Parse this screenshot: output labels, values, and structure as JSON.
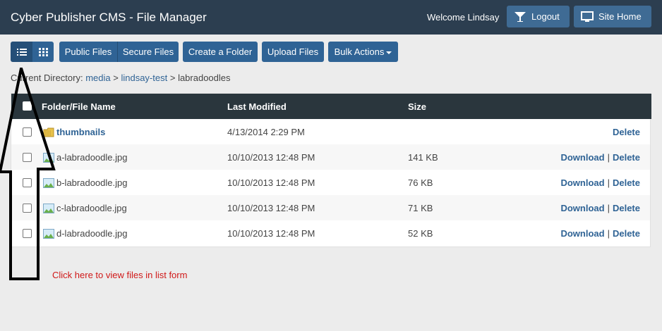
{
  "header": {
    "title": "Cyber Publisher CMS - File Manager",
    "welcome": "Welcome Lindsay",
    "logout_label": "Logout",
    "site_home_label": "Site Home"
  },
  "toolbar": {
    "public_files": "Public Files",
    "secure_files": "Secure Files",
    "create_folder": "Create a Folder",
    "upload_files": "Upload Files",
    "bulk_actions": "Bulk Actions"
  },
  "breadcrumb": {
    "prefix": "Current Directory:",
    "parts": [
      "media",
      "lindsay-test",
      "labradoodles"
    ],
    "sep": ">"
  },
  "table": {
    "headers": [
      "Folder/File Name",
      "Last Modified",
      "Size"
    ],
    "rows": [
      {
        "type": "folder",
        "name": "thumbnails",
        "modified": "4/13/2014 2:29 PM",
        "size": "",
        "download": "",
        "delete": "Delete"
      },
      {
        "type": "image",
        "name": "a-labradoodle.jpg",
        "modified": "10/10/2013 12:48 PM",
        "size": "141 KB",
        "download": "Download",
        "delete": "Delete"
      },
      {
        "type": "image",
        "name": "b-labradoodle.jpg",
        "modified": "10/10/2013 12:48 PM",
        "size": "76 KB",
        "download": "Download",
        "delete": "Delete"
      },
      {
        "type": "image",
        "name": "c-labradoodle.jpg",
        "modified": "10/10/2013 12:48 PM",
        "size": "71 KB",
        "download": "Download",
        "delete": "Delete"
      },
      {
        "type": "image",
        "name": "d-labradoodle.jpg",
        "modified": "10/10/2013 12:48 PM",
        "size": "52 KB",
        "download": "Download",
        "delete": "Delete"
      }
    ],
    "action_separator": "|"
  },
  "annotation": {
    "hint": "Click here to view files in list form"
  },
  "colors": {
    "topbar": "#2c3e50",
    "button": "#2f6395",
    "table_header": "#2a363d",
    "hint": "#d01818"
  },
  "icons": [
    "logout-icon",
    "monitor-icon",
    "list-view-icon",
    "grid-view-icon",
    "folder-icon",
    "image-file-icon",
    "arrow-annotation"
  ]
}
